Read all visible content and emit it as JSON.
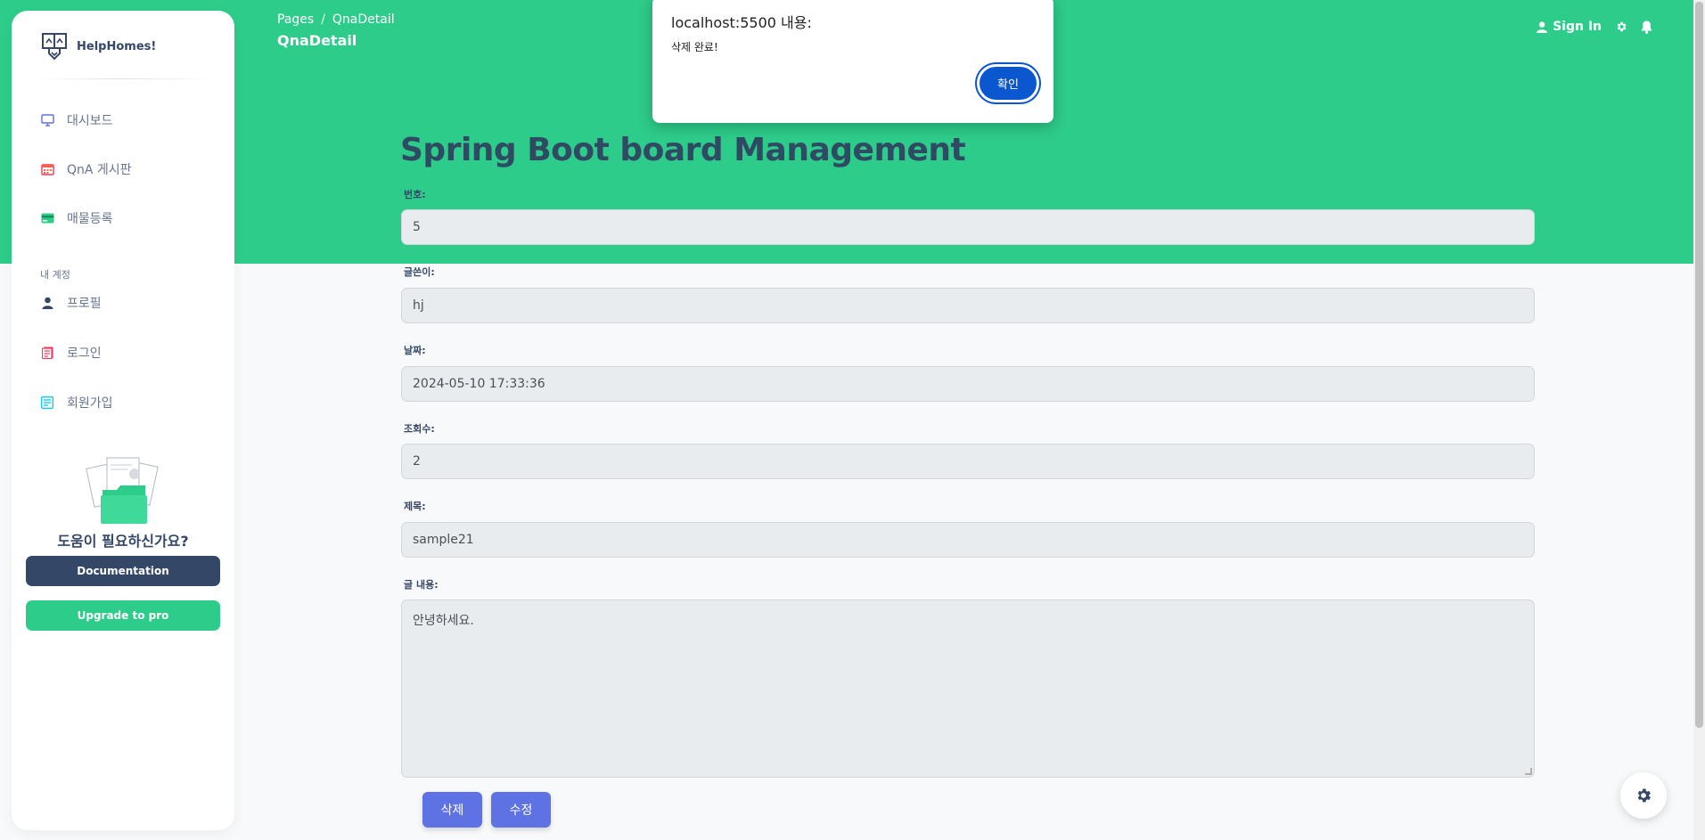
{
  "sidebar": {
    "brand": "HelpHomes!",
    "items": [
      {
        "label": "대시보드",
        "icon": "monitor-icon"
      },
      {
        "label": "QnA 게시판",
        "icon": "calendar-icon"
      },
      {
        "label": "매물등록",
        "icon": "credit-card-icon"
      }
    ],
    "account_section": "내 계정",
    "account_items": [
      {
        "label": "프로필",
        "icon": "user-icon"
      },
      {
        "label": "로그인",
        "icon": "document-icon"
      },
      {
        "label": "회원가입",
        "icon": "signup-icon"
      }
    ],
    "help_title": "도움이 필요하신가요?",
    "doc_button": "Documentation",
    "upgrade_button": "Upgrade to pro"
  },
  "navbar": {
    "breadcrumb_root": "Pages",
    "breadcrumb_sep": "/",
    "breadcrumb_current": "QnaDetail",
    "page_title": "QnaDetail",
    "signin_label": "Sign In"
  },
  "main": {
    "title": "Spring Boot board Management",
    "fields": [
      {
        "label": "번호:",
        "value": "5"
      },
      {
        "label": "글쓴이:",
        "value": "hj"
      },
      {
        "label": "날짜:",
        "value": "2024-05-10 17:33:36"
      },
      {
        "label": "조회수:",
        "value": "2"
      },
      {
        "label": "제목:",
        "value": "sample21"
      }
    ],
    "content_label": "글 내용:",
    "content_value": "안녕하세요.",
    "delete_button": "삭제",
    "edit_button": "수정"
  },
  "dialog": {
    "title": "localhost:5500 내용:",
    "message": "삭제 완료!",
    "ok_button": "확인"
  },
  "colors": {
    "hero": "#2ecc8a",
    "sidebar_dark": "#344767",
    "action": "#5e72e4",
    "dialog_button": "#0b57d0"
  }
}
